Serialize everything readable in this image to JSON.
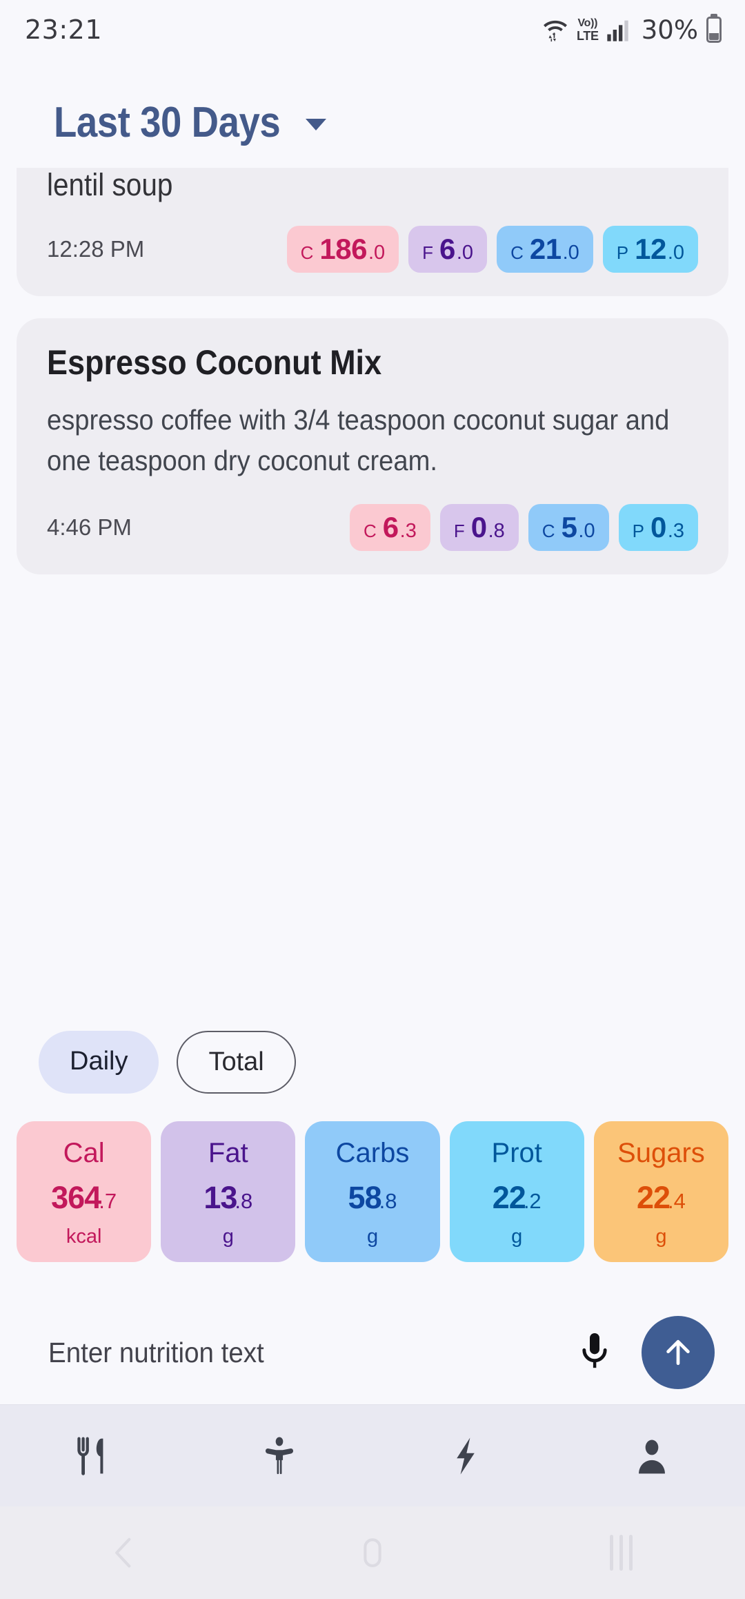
{
  "status_bar": {
    "time": "23:21",
    "volte_top": "Vo))",
    "volte_bottom": "LTE",
    "battery_percent": "30%",
    "icons": [
      "wifi-icon",
      "volte-icon",
      "cellular-signal-icon",
      "battery-icon"
    ]
  },
  "header": {
    "range_label": "Last 30 Days",
    "caret": "chevron-down-icon"
  },
  "entries": [
    {
      "title": "lentil soup",
      "description": "",
      "time": "12:28 PM",
      "clipped": true,
      "pills": [
        {
          "label": "C",
          "value": "186",
          "decimal": ".0",
          "type": "cal"
        },
        {
          "label": "F",
          "value": "6",
          "decimal": ".0",
          "type": "fat"
        },
        {
          "label": "C",
          "value": "21",
          "decimal": ".0",
          "type": "carb"
        },
        {
          "label": "P",
          "value": "12",
          "decimal": ".0",
          "type": "prot"
        }
      ]
    },
    {
      "title": "Espresso Coconut Mix",
      "description": "espresso coffee with 3/4 teaspoon coconut sugar and one teaspoon dry coconut cream.",
      "time": "4:46 PM",
      "clipped": false,
      "pills": [
        {
          "label": "C",
          "value": "6",
          "decimal": ".3",
          "type": "cal"
        },
        {
          "label": "F",
          "value": "0",
          "decimal": ".8",
          "type": "fat"
        },
        {
          "label": "C",
          "value": "5",
          "decimal": ".0",
          "type": "carb"
        },
        {
          "label": "P",
          "value": "0",
          "decimal": ".3",
          "type": "prot"
        }
      ]
    }
  ],
  "toggle": {
    "daily": "Daily",
    "total": "Total",
    "selected": "Daily"
  },
  "macros": [
    {
      "name": "Cal",
      "value": "364",
      "decimal": ".7",
      "unit": "kcal",
      "type": "cal",
      "color": "#c2185b"
    },
    {
      "name": "Fat",
      "value": "13",
      "decimal": ".8",
      "unit": "g",
      "type": "fat",
      "color": "#4a148c"
    },
    {
      "name": "Carbs",
      "value": "58",
      "decimal": ".8",
      "unit": "g",
      "type": "carb",
      "color": "#0d47a1"
    },
    {
      "name": "Prot",
      "value": "22",
      "decimal": ".2",
      "unit": "g",
      "type": "prot",
      "color": "#01579b"
    },
    {
      "name": "Sugars",
      "value": "22",
      "decimal": ".4",
      "unit": "g",
      "type": "sug",
      "color": "#dd4f09"
    }
  ],
  "input": {
    "placeholder": "Enter nutrition text",
    "value": "",
    "mic_icon": "microphone-icon",
    "send_icon": "arrow-up-icon",
    "send_color": "#3f5d93"
  },
  "bottom_nav": {
    "items": [
      {
        "icon": "fork-knife-icon",
        "name": "nav-food"
      },
      {
        "icon": "body-person-icon",
        "name": "nav-body"
      },
      {
        "icon": "lightning-bolt-icon",
        "name": "nav-activity"
      },
      {
        "icon": "person-icon",
        "name": "nav-profile"
      }
    ]
  },
  "system_nav": {
    "back": "back-chevron-icon",
    "home": "home-pill-icon",
    "recents": "recents-bars-icon"
  }
}
